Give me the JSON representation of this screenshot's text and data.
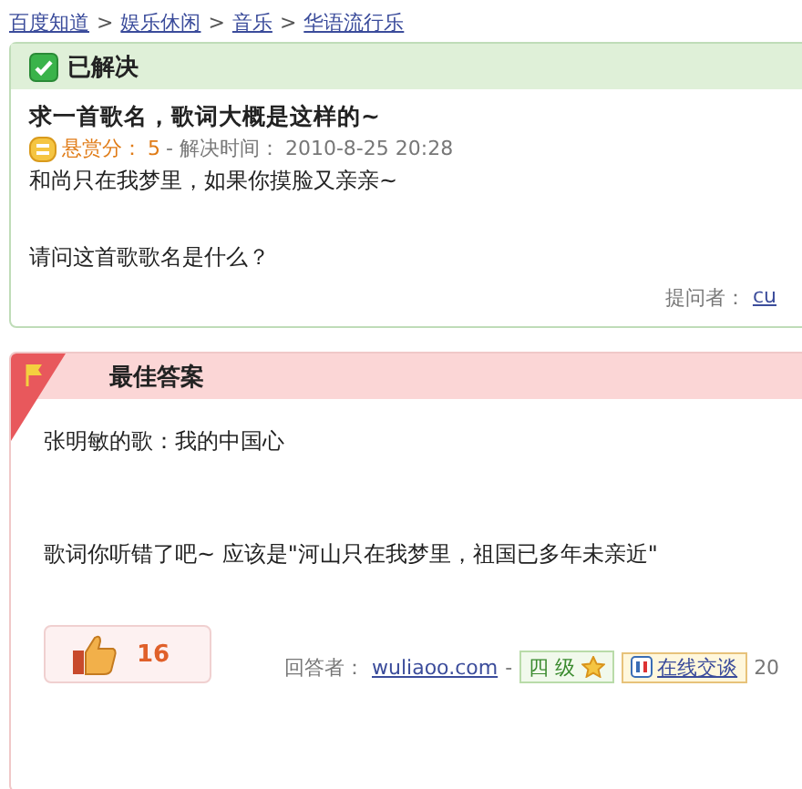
{
  "breadcrumb": [
    {
      "label": "百度知道"
    },
    {
      "label": "娱乐休闲"
    },
    {
      "label": "音乐"
    },
    {
      "label": "华语流行乐"
    }
  ],
  "breadcrumb_separator": ">",
  "question": {
    "status": "已解决",
    "resolved": true,
    "title": "求一首歌名，歌词大概是这样的~",
    "reward_label": "悬赏分：",
    "reward": "5",
    "time_label": "- 解决时间：",
    "time": "2010-8-25 20:28",
    "paragraphs": [
      "和尚只在我梦里，如果你摸脸又亲亲~",
      "请问这首歌歌名是什么？"
    ],
    "asker_label": "提问者：",
    "asker": "cu"
  },
  "answer": {
    "heading": "最佳答案",
    "paragraphs": [
      "张明敏的歌：我的中国心",
      "歌词你听错了吧~  应该是\"河山只在我梦里，祖国已多年未亲近\""
    ],
    "likes": "16",
    "answerer_label": "回答者：",
    "answerer": "wuliaoo.com",
    "separator": "-",
    "level": "四 级",
    "chat": "在线交谈",
    "date": "20"
  }
}
